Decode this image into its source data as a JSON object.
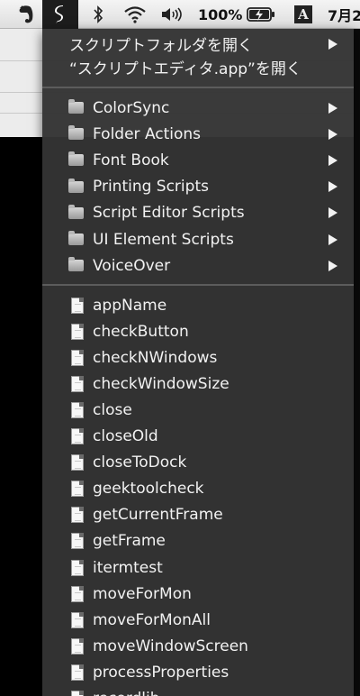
{
  "menubar": {
    "battery_text": "100%",
    "date_text": "7月2"
  },
  "dropdown": {
    "header_items": [
      {
        "label": "スクリプトフォルダを開く",
        "has_submenu": true
      },
      {
        "label": "“スクリプトエディタ.app”を開く",
        "has_submenu": false
      }
    ],
    "folders": [
      {
        "label": "ColorSync"
      },
      {
        "label": "Folder Actions"
      },
      {
        "label": "Font Book"
      },
      {
        "label": "Printing Scripts"
      },
      {
        "label": "Script Editor Scripts"
      },
      {
        "label": "UI Element Scripts"
      },
      {
        "label": "VoiceOver"
      }
    ],
    "scripts": [
      {
        "label": "appName"
      },
      {
        "label": "checkButton"
      },
      {
        "label": "checkNWindows"
      },
      {
        "label": "checkWindowSize"
      },
      {
        "label": "close"
      },
      {
        "label": "closeOld"
      },
      {
        "label": "closeToDock"
      },
      {
        "label": "geektoolcheck"
      },
      {
        "label": "getCurrentFrame"
      },
      {
        "label": "getFrame"
      },
      {
        "label": "itermtest"
      },
      {
        "label": "moveForMon"
      },
      {
        "label": "moveForMonAll"
      },
      {
        "label": "moveWindowScreen"
      },
      {
        "label": "processProperties"
      },
      {
        "label": "recordlib"
      }
    ]
  }
}
